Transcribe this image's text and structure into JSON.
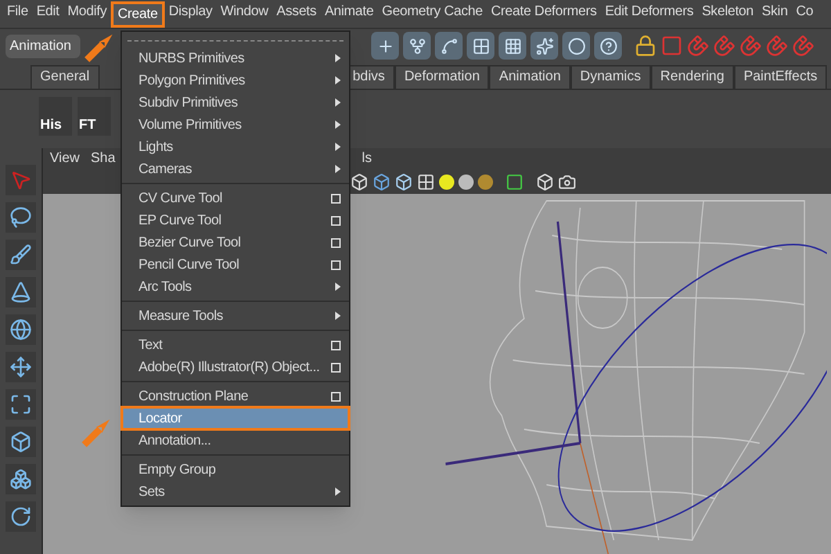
{
  "menu_bar": [
    {
      "label": "File",
      "selected": false
    },
    {
      "label": "Edit",
      "selected": false
    },
    {
      "label": "Modify",
      "selected": false
    },
    {
      "label": "Create",
      "selected": true
    },
    {
      "label": "Display",
      "selected": false
    },
    {
      "label": "Window",
      "selected": false
    },
    {
      "label": "Assets",
      "selected": false
    },
    {
      "label": "Animate",
      "selected": false
    },
    {
      "label": "Geometry Cache",
      "selected": false
    },
    {
      "label": "Create Deformers",
      "selected": false
    },
    {
      "label": "Edit Deformers",
      "selected": false
    },
    {
      "label": "Skeleton",
      "selected": false
    },
    {
      "label": "Skin",
      "selected": false
    },
    {
      "label": "Co",
      "selected": false
    }
  ],
  "menu_set": {
    "value": "Animation"
  },
  "shelf_tabs": [
    {
      "label": "General",
      "selected": false
    },
    {
      "label": "bdivs",
      "selected": false
    },
    {
      "label": "Deformation",
      "selected": false
    },
    {
      "label": "Animation",
      "selected": false
    },
    {
      "label": "Dynamics",
      "selected": false
    },
    {
      "label": "Rendering",
      "selected": false
    },
    {
      "label": "PaintEffects",
      "selected": false
    }
  ],
  "shelf_items": [
    "His",
    "FT"
  ],
  "panel_menu": [
    "View",
    "Sha",
    "ls"
  ],
  "create_menu": [
    {
      "items": [
        {
          "label": "NURBS Primitives",
          "kind": "submenu",
          "selected": false
        },
        {
          "label": "Polygon Primitives",
          "kind": "submenu",
          "selected": false
        },
        {
          "label": "Subdiv Primitives",
          "kind": "submenu",
          "selected": false
        },
        {
          "label": "Volume Primitives",
          "kind": "submenu",
          "selected": false
        },
        {
          "label": "Lights",
          "kind": "submenu",
          "selected": false
        },
        {
          "label": "Cameras",
          "kind": "submenu",
          "selected": false
        }
      ]
    },
    {
      "items": [
        {
          "label": "CV Curve Tool",
          "kind": "option",
          "selected": false
        },
        {
          "label": "EP Curve Tool",
          "kind": "option",
          "selected": false
        },
        {
          "label": "Bezier Curve Tool",
          "kind": "option",
          "selected": false
        },
        {
          "label": "Pencil Curve Tool",
          "kind": "option",
          "selected": false
        },
        {
          "label": "Arc Tools",
          "kind": "submenu",
          "selected": false
        }
      ]
    },
    {
      "items": [
        {
          "label": "Measure Tools",
          "kind": "submenu",
          "selected": false
        }
      ]
    },
    {
      "items": [
        {
          "label": "Text",
          "kind": "option",
          "selected": false
        },
        {
          "label": "Adobe(R) Illustrator(R) Object...",
          "kind": "option",
          "selected": false
        }
      ]
    },
    {
      "items": [
        {
          "label": "Construction Plane",
          "kind": "option",
          "selected": false
        },
        {
          "label": "Locator",
          "kind": "plain",
          "selected": true
        },
        {
          "label": "Annotation...",
          "kind": "plain",
          "selected": false
        }
      ]
    },
    {
      "items": [
        {
          "label": "Empty Group",
          "kind": "plain",
          "selected": false
        },
        {
          "label": "Sets",
          "kind": "submenu",
          "selected": false
        }
      ]
    }
  ]
}
